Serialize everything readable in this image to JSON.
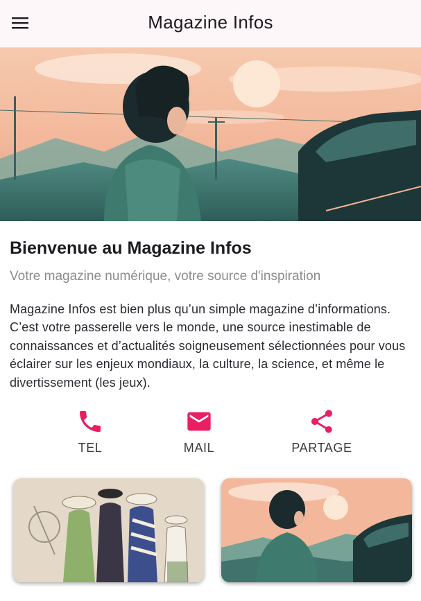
{
  "appbar": {
    "title": "Magazine Infos",
    "menu_icon": "hamburger-menu-icon"
  },
  "hero": {
    "image_desc": "anime-boy-sunset-illustration"
  },
  "intro": {
    "headline": "Bienvenue au Magazine Infos",
    "subtitle": "Votre magazine numérique, votre source d'inspiration",
    "body": "Magazine Infos est bien plus qu’un simple magazine d’informations. C’est votre passerelle vers le monde, une source inestimable de connaissances et d’actualités soigneusement sélectionnées pour vous éclairer sur les enjeux mondiaux, la culture, la science, et même le divertissement (les jeux)."
  },
  "actions": [
    {
      "label": "TEL",
      "icon": "phone-icon"
    },
    {
      "label": "MAIL",
      "icon": "mail-icon"
    },
    {
      "label": "PARTAGE",
      "icon": "share-icon"
    }
  ],
  "colors": {
    "accent": "#e91e63",
    "appbar_bg": "#fef7fa",
    "subtitle": "#8e8a8f"
  },
  "cards": [
    {
      "image": "vintage-fashion-illustration"
    },
    {
      "image": "anime-boy-sunset-illustration"
    }
  ]
}
